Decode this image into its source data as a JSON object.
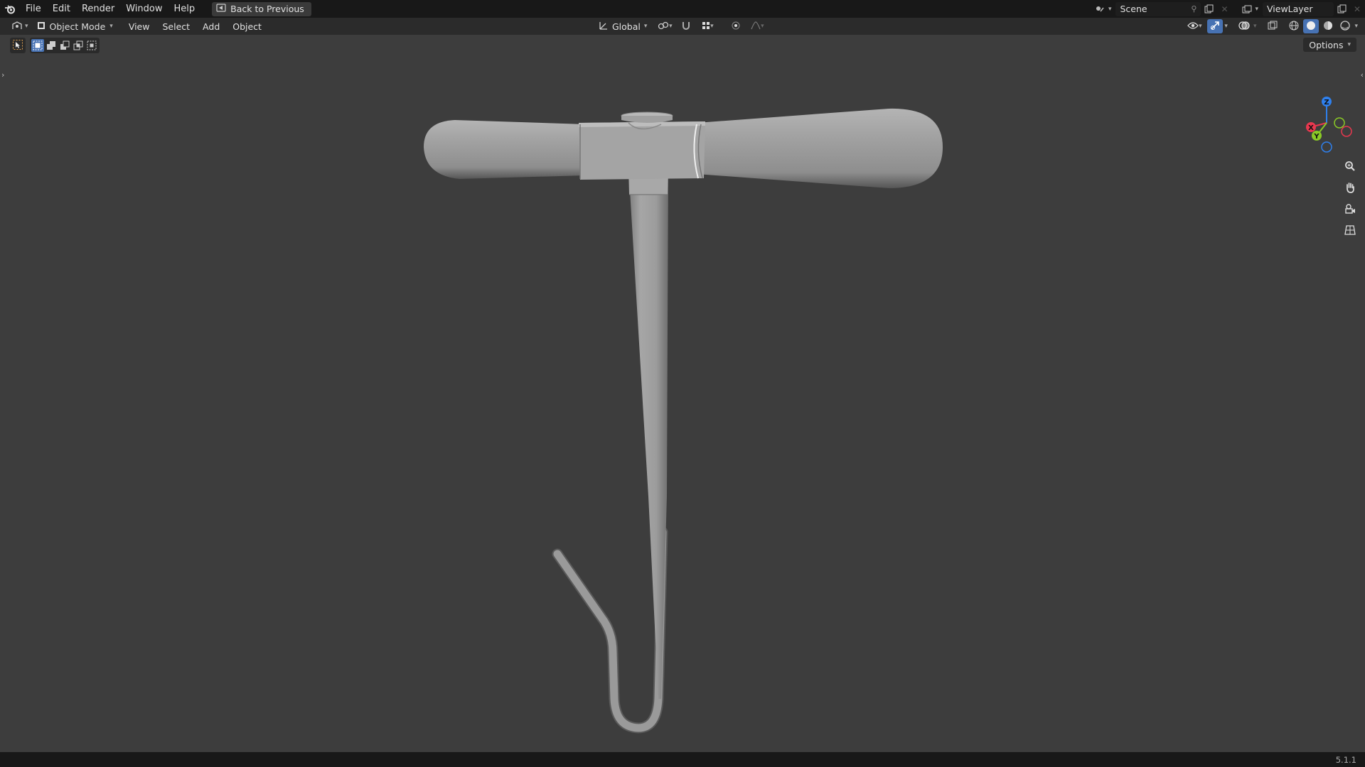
{
  "topbar": {
    "menus": [
      "File",
      "Edit",
      "Render",
      "Window",
      "Help"
    ],
    "back_label": "Back to Previous",
    "scene_name": "Scene",
    "view_layer_name": "ViewLayer"
  },
  "header": {
    "editor_type_icon": "viewport-icon",
    "mode_label": "Object Mode",
    "menus": [
      "View",
      "Select",
      "Add",
      "Object"
    ],
    "transform_orientation": "Global",
    "snapping_active": false,
    "gizmo_active": true,
    "shading_mode": "solid"
  },
  "tool_settings": {
    "options_label": "Options",
    "selection_mode": "set"
  },
  "gizmo": {
    "x_label": "X",
    "y_label": "Y",
    "z_label": "Z",
    "colors": {
      "x": "#e8384f",
      "y": "#8ac926",
      "z": "#2f80ed"
    }
  },
  "status": {
    "version": "5.1.1"
  },
  "colors": {
    "accent": "#4772b3",
    "background": "#3d3d3d",
    "model": "#9e9e9e"
  }
}
